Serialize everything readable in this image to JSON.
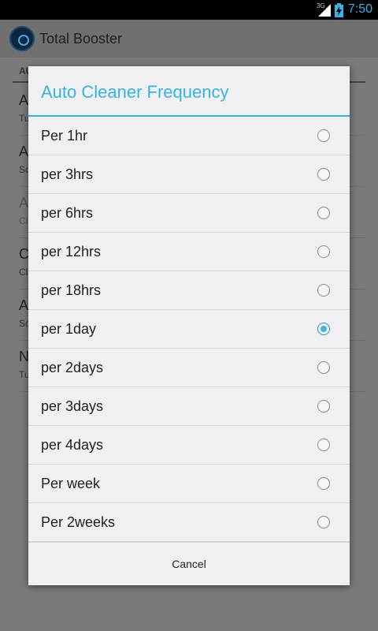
{
  "status_bar": {
    "network": "3G",
    "time": "7:50",
    "icons": [
      "signal-icon",
      "battery-charging-icon"
    ],
    "time_color": "#33b5e5"
  },
  "app": {
    "title": "Total Booster",
    "section_header": "AU",
    "rows": [
      {
        "title": "A",
        "subtitle": "Tu"
      },
      {
        "title": "A",
        "subtitle": "Sc"
      },
      {
        "title": "A",
        "subtitle": "Cl"
      },
      {
        "title": "C",
        "subtitle": "Cl"
      },
      {
        "title": "A",
        "subtitle": "Sc"
      },
      {
        "title": "N",
        "subtitle": "Tu"
      }
    ]
  },
  "dialog": {
    "title": "Auto Cleaner Frequency",
    "accent_color": "#33b5e5",
    "options": [
      {
        "label": "Per 1hr",
        "selected": false
      },
      {
        "label": "per 3hrs",
        "selected": false
      },
      {
        "label": "per 6hrs",
        "selected": false
      },
      {
        "label": "per 12hrs",
        "selected": false
      },
      {
        "label": "per 18hrs",
        "selected": false
      },
      {
        "label": "per 1day",
        "selected": true
      },
      {
        "label": "per 2days",
        "selected": false
      },
      {
        "label": "per 3days",
        "selected": false
      },
      {
        "label": "per 4days",
        "selected": false
      },
      {
        "label": "Per week",
        "selected": false
      },
      {
        "label": "Per 2weeks",
        "selected": false
      }
    ],
    "cancel_label": "Cancel"
  }
}
